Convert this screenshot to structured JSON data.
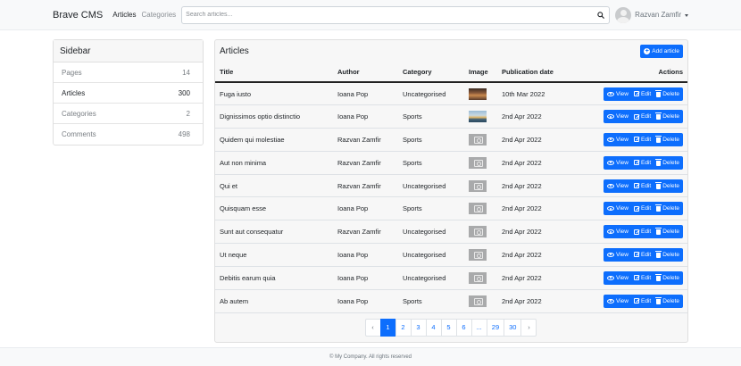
{
  "navbar": {
    "brand": "Brave CMS",
    "links": [
      "Articles",
      "Categories"
    ],
    "search": {
      "placeholder": "Search articles..."
    },
    "user": {
      "name": "Razvan Zamfir"
    }
  },
  "sidebar": {
    "title": "Sidebar",
    "items": [
      {
        "label": "Pages",
        "count": "14"
      },
      {
        "label": "Articles",
        "count": "300"
      },
      {
        "label": "Categories",
        "count": "2"
      },
      {
        "label": "Comments",
        "count": "498"
      }
    ]
  },
  "articles": {
    "title": "Articles",
    "add_label": "Add article",
    "columns": {
      "title": "Title",
      "author": "Author",
      "category": "Category",
      "image": "Image",
      "date": "Publication date",
      "actions": "Actions"
    },
    "actions": {
      "view": "View",
      "edit": "Edit",
      "delete": "Delete"
    },
    "rows": [
      {
        "title": "Fuga iusto",
        "author": "Ioana Pop",
        "category": "Uncategorised",
        "image": "photo1",
        "date": "10th Mar 2022"
      },
      {
        "title": "Dignissimos optio distinctio",
        "author": "Ioana Pop",
        "category": "Sports",
        "image": "photo2",
        "date": "2nd Apr 2022"
      },
      {
        "title": "Quidem qui molestiae",
        "author": "Razvan Zamfir",
        "category": "Sports",
        "image": "placeholder",
        "date": "2nd Apr 2022"
      },
      {
        "title": "Aut non minima",
        "author": "Razvan Zamfir",
        "category": "Sports",
        "image": "placeholder",
        "date": "2nd Apr 2022"
      },
      {
        "title": "Qui et",
        "author": "Razvan Zamfir",
        "category": "Uncategorised",
        "image": "placeholder",
        "date": "2nd Apr 2022"
      },
      {
        "title": "Quisquam esse",
        "author": "Ioana Pop",
        "category": "Sports",
        "image": "placeholder",
        "date": "2nd Apr 2022"
      },
      {
        "title": "Sunt aut consequatur",
        "author": "Razvan Zamfir",
        "category": "Uncategorised",
        "image": "placeholder",
        "date": "2nd Apr 2022"
      },
      {
        "title": "Ut neque",
        "author": "Ioana Pop",
        "category": "Uncategorised",
        "image": "placeholder",
        "date": "2nd Apr 2022"
      },
      {
        "title": "Debitis earum quia",
        "author": "Ioana Pop",
        "category": "Uncategorised",
        "image": "placeholder",
        "date": "2nd Apr 2022"
      },
      {
        "title": "Ab autem",
        "author": "Ioana Pop",
        "category": "Sports",
        "image": "placeholder",
        "date": "2nd Apr 2022"
      }
    ]
  },
  "pagination": {
    "prev": "‹",
    "next": "›",
    "pages": [
      "1",
      "2",
      "3",
      "4",
      "5",
      "6",
      "...",
      "29",
      "30"
    ],
    "current": "1"
  },
  "footer": {
    "text": "© My Company. All rights reserved"
  },
  "colors": {
    "primary": "#0d6efd",
    "navbar_bg": "#f8f9fa"
  },
  "icons": {
    "search": "search-icon",
    "view": "eye-icon",
    "edit": "edit-icon",
    "delete": "trash-icon",
    "add": "plus-circle-icon"
  }
}
